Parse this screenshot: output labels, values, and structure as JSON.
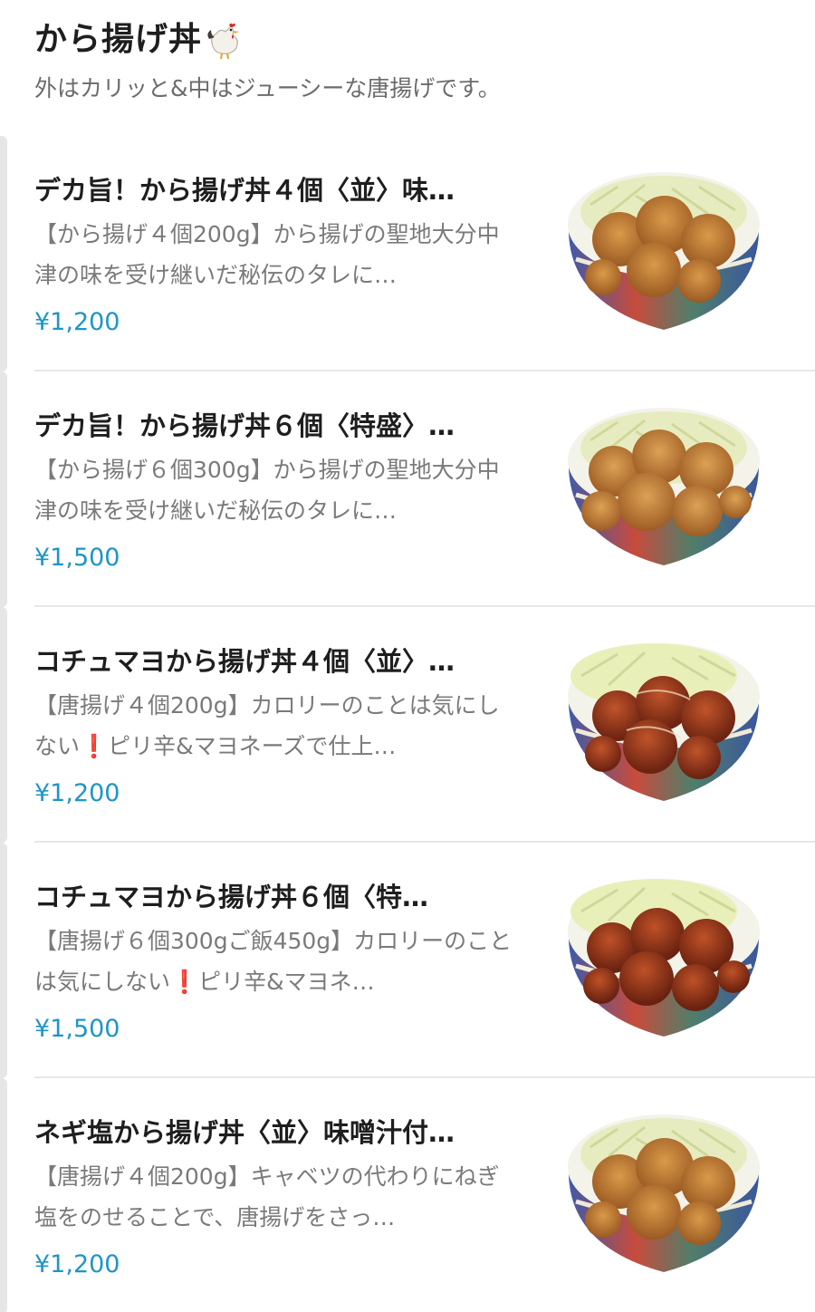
{
  "section": {
    "title": "から揚げ丼",
    "title_icon": "rooster-icon",
    "subtitle": "外はカリッと&中はジューシーな唐揚げです。"
  },
  "items": [
    {
      "name": "デカ旨！から揚げ丼４個〈並〉味…",
      "description": "【から揚げ４個200g】から揚げの聖地大分中津の味を受け継いだ秘伝のタレに…",
      "price": "¥1,200",
      "image": "karaage-bowl-photo"
    },
    {
      "name": "デカ旨！から揚げ丼６個〈特盛〉…",
      "description": "【から揚げ６個300g】から揚げの聖地大分中津の味を受け継いだ秘伝のタレに…",
      "price": "¥1,500",
      "image": "karaage-bowl-photo"
    },
    {
      "name": "コチュマヨから揚げ丼４個〈並〉…",
      "description": "【唐揚げ４個200g】カロリーのことは気にしない❗ピリ辛&マヨネーズで仕上…",
      "price": "¥1,200",
      "image": "gochujang-mayo-karaage-bowl-photo"
    },
    {
      "name": "コチュマヨから揚げ丼６個〈特…",
      "description": "【唐揚げ６個300gご飯450g】カロリーのことは気にしない❗ピリ辛&マヨネ…",
      "price": "¥1,500",
      "image": "gochujang-mayo-karaage-bowl-photo"
    },
    {
      "name": "ネギ塩から揚げ丼〈並〉味噌汁付…",
      "description": "【唐揚げ４個200g】キャベツの代わりにねぎ塩をのせることで、唐揚げをさっ…",
      "price": "¥1,200",
      "image": "karaage-bowl-photo"
    }
  ],
  "colors": {
    "price": "#1e95c8",
    "divider": "#e7e7e7",
    "description": "#7a7a7a"
  }
}
